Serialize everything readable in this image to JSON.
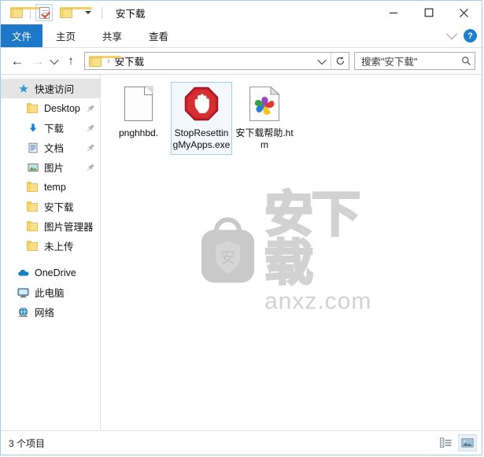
{
  "window": {
    "title": "安下载",
    "quick_access_toolbar": [
      {
        "name": "folder-icon",
        "label": "属性"
      },
      {
        "name": "properties-icon",
        "label": "属性"
      },
      {
        "name": "new-folder-icon",
        "label": "新建文件夹"
      },
      {
        "name": "chevron-down-icon",
        "label": "自定义快速访问工具栏"
      }
    ],
    "controls": {
      "minimize": "—",
      "maximize": "□",
      "close": "✕"
    }
  },
  "ribbon": {
    "tabs": [
      {
        "label": "文件",
        "active": true
      },
      {
        "label": "主页",
        "active": false
      },
      {
        "label": "共享",
        "active": false
      },
      {
        "label": "查看",
        "active": false
      }
    ],
    "collapse_icon": "chevron-down-icon",
    "help_label": "?"
  },
  "address": {
    "back_label": "←",
    "forward_label": "→",
    "recent_label": "⌄",
    "up_label": "↑",
    "crumbs": [
      "安下载"
    ],
    "crumb_separator": "›",
    "history_label": "⌄",
    "refresh_label": "↻"
  },
  "search": {
    "placeholder": "搜索\"安下载\"",
    "icon": "search-icon"
  },
  "sidebar": {
    "items": [
      {
        "label": "快速访问",
        "icon": "star-icon",
        "level": 0,
        "selected": true,
        "pinned": false
      },
      {
        "label": "Desktop",
        "icon": "folder-icon",
        "level": 1,
        "selected": false,
        "pinned": true
      },
      {
        "label": "下载",
        "icon": "download-icon",
        "level": 1,
        "selected": false,
        "pinned": true
      },
      {
        "label": "文档",
        "icon": "documents-icon",
        "level": 1,
        "selected": false,
        "pinned": true
      },
      {
        "label": "图片",
        "icon": "pictures-icon",
        "level": 1,
        "selected": false,
        "pinned": true
      },
      {
        "label": "temp",
        "icon": "folder-icon",
        "level": 1,
        "selected": false,
        "pinned": false
      },
      {
        "label": "安下载",
        "icon": "folder-icon",
        "level": 1,
        "selected": false,
        "pinned": false
      },
      {
        "label": "图片管理器",
        "icon": "folder-icon",
        "level": 1,
        "selected": false,
        "pinned": false
      },
      {
        "label": "未上传",
        "icon": "folder-icon",
        "level": 1,
        "selected": false,
        "pinned": false
      },
      {
        "label": "OneDrive",
        "icon": "cloud-icon",
        "level": 0,
        "selected": false,
        "pinned": false
      },
      {
        "label": "此电脑",
        "icon": "computer-icon",
        "level": 0,
        "selected": false,
        "pinned": false
      },
      {
        "label": "网络",
        "icon": "network-icon",
        "level": 0,
        "selected": false,
        "pinned": false
      }
    ]
  },
  "files": [
    {
      "name": "pnghhbd.",
      "icon": "blank-document-icon",
      "selected": false
    },
    {
      "name": "StopResettingMyApps.exe",
      "icon": "stop-sign-hand-icon",
      "selected": true
    },
    {
      "name": "安下载帮助.htm",
      "icon": "browser-pinwheel-document-icon",
      "selected": false
    }
  ],
  "watermark": {
    "logo_char": "安",
    "brand": "安下载",
    "domain": "anxz.com"
  },
  "statusbar": {
    "item_count": "3 个项目",
    "views": [
      {
        "name": "details-view",
        "active": false
      },
      {
        "name": "large-icons-view",
        "active": true
      }
    ]
  },
  "colors": {
    "accent": "#1e78c8",
    "window_border": "#9fd0e7",
    "selection_bg": "#f2f8fd",
    "selection_border": "#a5cdeb",
    "folder_yellow": "#fbe08a",
    "stop_red": "#d0232b"
  }
}
